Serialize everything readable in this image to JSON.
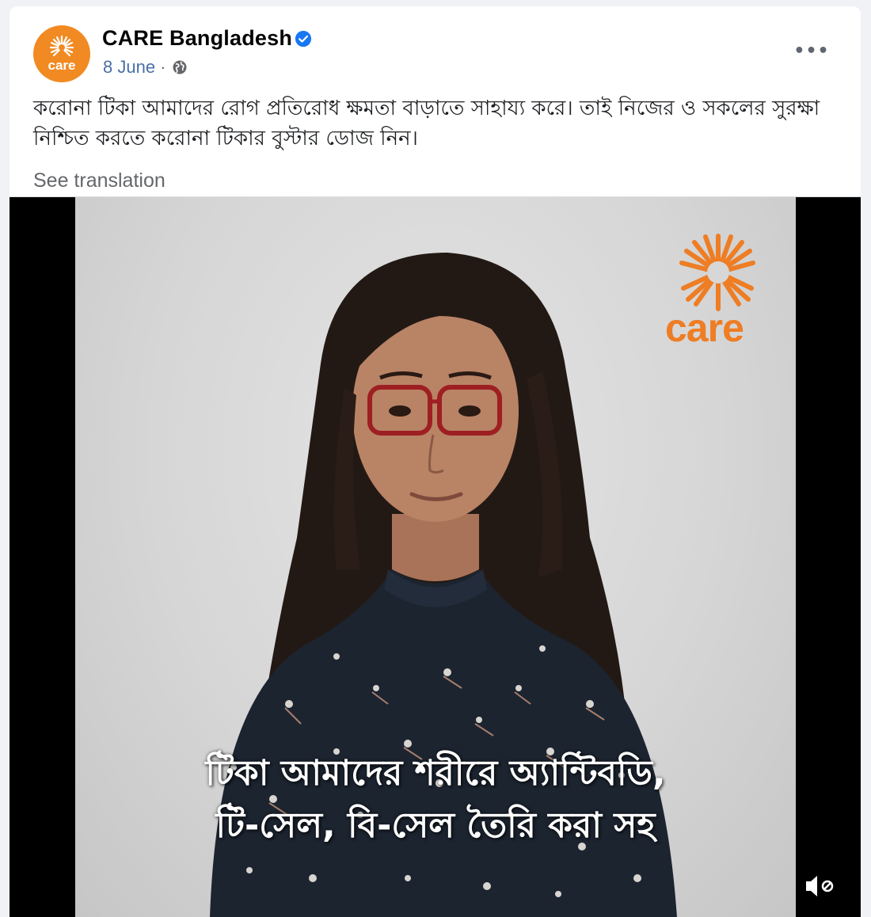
{
  "post": {
    "page_name": "CARE Bangladesh",
    "date": "8 June",
    "separator": "·",
    "more_label": "•••",
    "text_line1": "করোনা টিকা আমাদের রোগ প্রতিরোধ ক্ষমতা বাড়াতে সাহায্য করে। তাই নিজের ও সকলের সুরক্ষা",
    "text_line2": "নিশ্চিত করতে করোনা টিকার বুস্টার ডোজ নিন।",
    "see_translation": "See translation"
  },
  "video": {
    "logo_text": "care",
    "caption_line1": "টিকা আমাদের শরীরে অ্যান্টিবডি,",
    "caption_line2": "টি-সেল, বি-সেল তৈরি করা সহ"
  },
  "icons": {
    "verified": "verified-badge-icon",
    "privacy": "globe-icon",
    "more": "more-options-icon",
    "mute": "muted-speaker-icon"
  },
  "colors": {
    "brand_orange": "#f18a22",
    "verified_blue": "#1877f2",
    "date_link": "#4a6fa5",
    "secondary_text": "#65676b"
  }
}
